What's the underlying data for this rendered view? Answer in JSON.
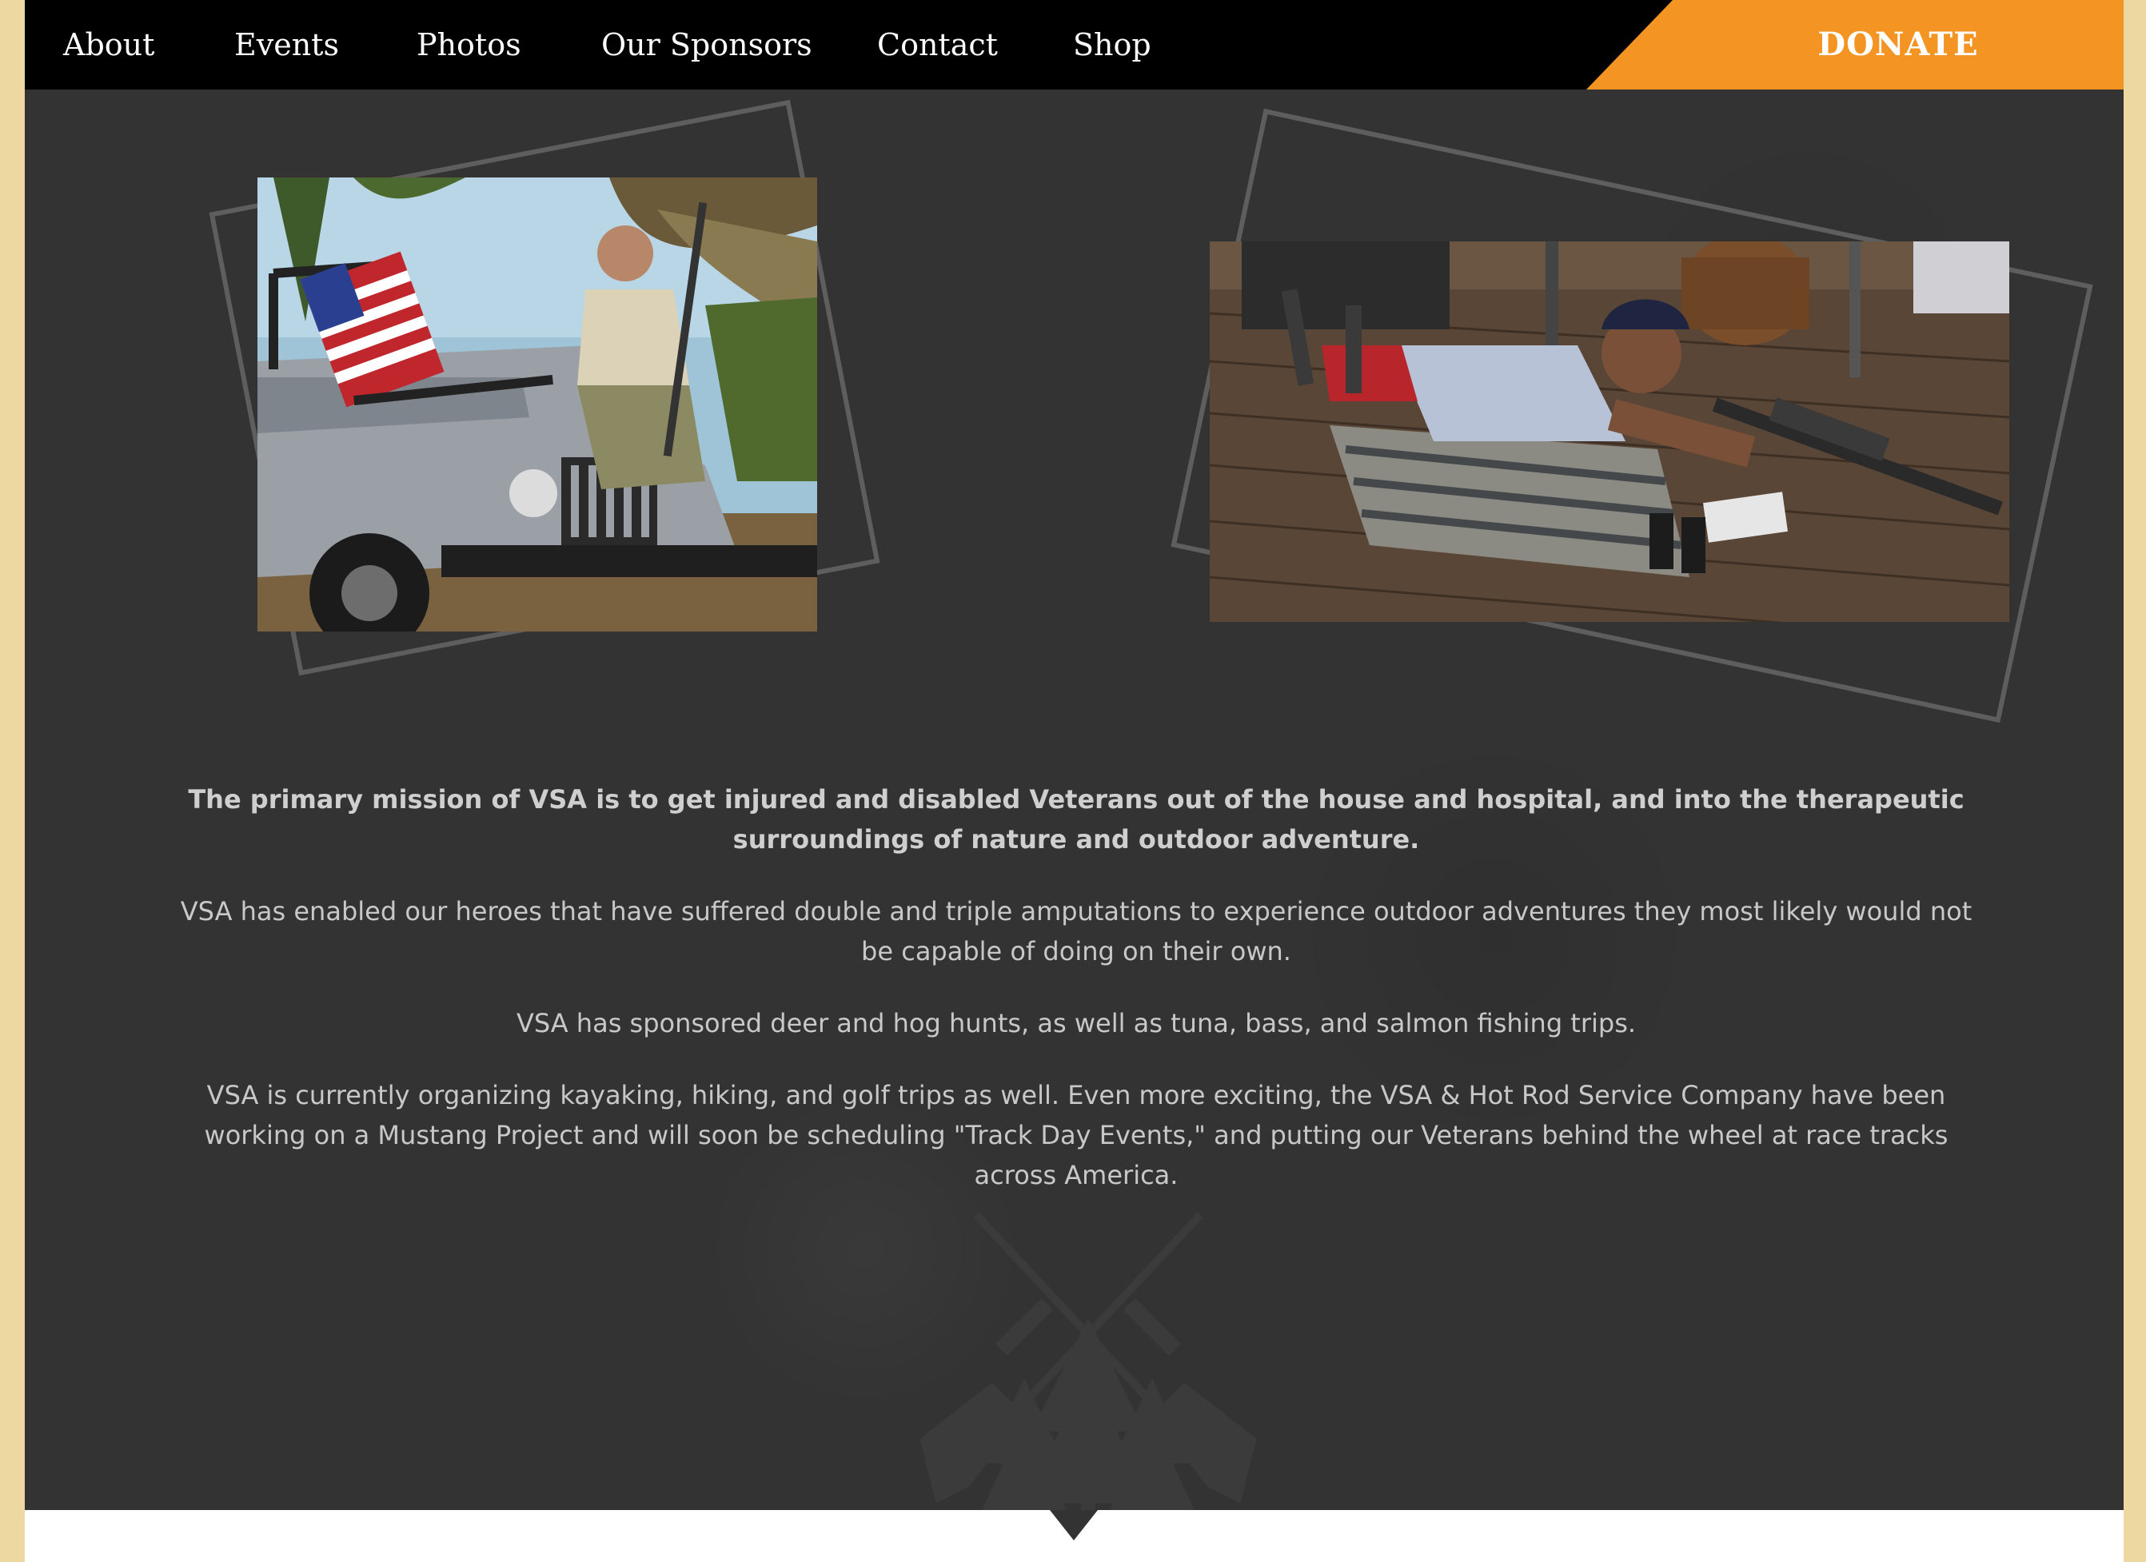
{
  "nav": {
    "items": [
      {
        "label": "About"
      },
      {
        "label": "Events"
      },
      {
        "label": "Photos"
      },
      {
        "label": "Our Sponsors"
      },
      {
        "label": "Contact"
      },
      {
        "label": "Shop"
      }
    ],
    "donate_label": "DONATE",
    "donate_color": "#f39423"
  },
  "content": {
    "lead": "The primary mission of VSA is to get injured and disabled Veterans out of the house and hospital, and into the therapeutic surroundings of nature and outdoor adventure.",
    "paragraphs": [
      "VSA has enabled our heroes that have suffered double and triple amputations to experience outdoor adventures they most likely would not be capable of doing on their own.",
      "VSA has sponsored deer and hog hunts, as well as tuna, bass, and salmon fishing trips.",
      "VSA is currently organizing kayaking, hiking, and golf trips as well. Even more exciting, the VSA & Hot Rod Service Company have been working on a Mustang Project and will soon be scheduling \"Track Day Events,\" and putting our Veterans behind the wheel at race tracks across America."
    ]
  },
  "colors": {
    "background": "#333333",
    "page_border": "#ecd8a0",
    "nav_background": "#000000"
  },
  "icons": {
    "emblem": "crossed-rifles-trees-icon"
  }
}
